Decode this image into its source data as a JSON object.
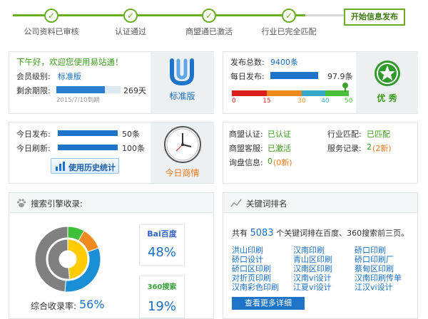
{
  "steps": [
    {
      "label": "公司资料已审核"
    },
    {
      "label": "认证通过"
    },
    {
      "label": "商盟通已激活"
    },
    {
      "label": "行业已完全匹配"
    }
  ],
  "step_final": "开始信息发布",
  "welcome": {
    "greeting": "下午好，欢迎您使用易站通！",
    "level_label": "会员级别:",
    "level_value": "标准版",
    "remain_label": "剩余期限:",
    "remain_value": "269天",
    "expire": "2015/7/10到期",
    "remain_fraction": 0.75,
    "badge_label": "标准版"
  },
  "publish": {
    "total_label": "发布总数:",
    "total_value": "9400条",
    "daily_label": "每日发布:",
    "daily_value": "97.9条",
    "daily_fraction": 0.8,
    "scale": [
      "0",
      "15",
      "30",
      "40",
      "50"
    ],
    "scale_colors": [
      "#d9201f",
      "#f08a1c",
      "#36a9c9",
      "#4cbf3a"
    ],
    "marker_value": 48.5,
    "rating": "优 秀"
  },
  "today": {
    "publish_label": "今日发布:",
    "publish_value": "50条",
    "refresh_label": "今日刷新:",
    "refresh_value": "100条",
    "history_btn": "使用历史统计",
    "clock_title": "今日商情"
  },
  "status": {
    "cert_label": "商盟认证:",
    "cert_value": "已认证",
    "service_label": "商盟客服:",
    "service_value": "已激活",
    "inquiry_label": "询盘信息:",
    "inquiry_value": "0",
    "inquiry_new": "(0新)",
    "match_label": "行业匹配:",
    "match_value": "已匹配",
    "record_label": "服务记录:",
    "record_value": "2",
    "record_new": "(2新)"
  },
  "search": {
    "title": "搜索引擎收录:",
    "rate_label": "综合收录率:",
    "rate_value": "56%",
    "engines": [
      {
        "name": "Bai百度",
        "value": "48%"
      },
      {
        "name": "360搜索",
        "value": "19%"
      }
    ],
    "donut_colors": [
      "#1a8fd6",
      "#ffcc00",
      "#f08a1c",
      "#3fbf3a",
      "#808080"
    ]
  },
  "keywords": {
    "title": "关键词排名",
    "summary_pre": "共有",
    "summary_count": "5083",
    "summary_post": "个关键词排在百度、360搜索前三页。",
    "items": [
      "洪山印刷",
      "汉南印刷",
      "硚口印刷",
      "硚口设计",
      "青山区印刷",
      "硚口印刷厂",
      "硚口区印刷",
      "汉南区印刷",
      "蔡甸区印刷",
      "对折页印刷",
      "汉南vi设计",
      "汉南印刷传单",
      "汉南彩色印刷",
      "江夏vi设计",
      "江汉vi设计"
    ],
    "more_btn": "查看更多详细"
  }
}
